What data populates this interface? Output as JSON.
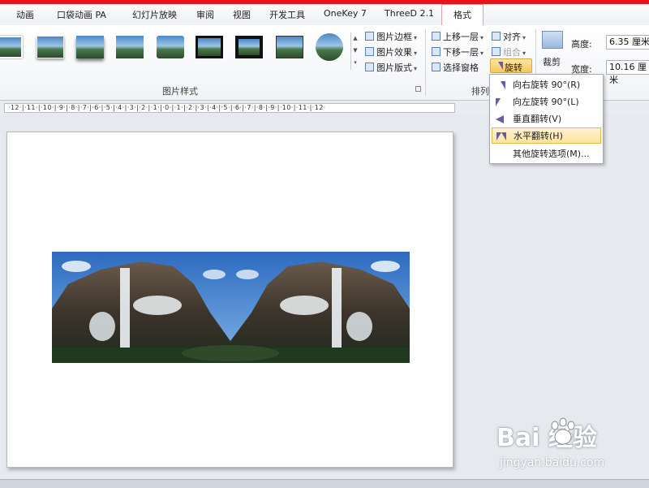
{
  "tabs": [
    "动画",
    "口袋动画 PA",
    "幻灯片放映",
    "审阅",
    "视图",
    "开发工具",
    "OneKey 7",
    "ThreeD 2.1",
    "格式"
  ],
  "picture_styles": {
    "group_label": "图片样式",
    "commands": {
      "border": "图片边框",
      "effects": "图片效果",
      "layout": "图片版式"
    }
  },
  "arrange": {
    "group_label": "排列",
    "bring_forward": "上移一层",
    "send_backward": "下移一层",
    "selection_pane": "选择窗格",
    "align": "对齐",
    "group": "组合",
    "rotate": "旋转"
  },
  "size": {
    "crop": "裁剪",
    "height_label": "高度:",
    "height_value": "6.35 厘米",
    "width_label": "宽度:",
    "width_value": "10.16 厘米"
  },
  "ruler": {
    "text": "·12·|·11·|·10·|·9·|·8·|·7·|·6·|·5·|·4·|·3·|·2·|·1·|·0·|·1·|·2·|·3·|·4·|·5·|·6·|·7·|·8·|·9·|·10·|·11·|·12·"
  },
  "rotate_menu": {
    "items": [
      "向右旋转 90°(R)",
      "向左旋转 90°(L)",
      "垂直翻转(V)",
      "水平翻转(H)",
      "其他旋转选项(M)..."
    ],
    "highlighted": "水平翻转(H)"
  },
  "watermark": {
    "logo": "Bai  经验",
    "url": "jingyan.baidu.com"
  },
  "colors": {
    "accent_red": "#e8141b",
    "active_tab_border": "#e6a0a6",
    "highlight": "#fde39b"
  }
}
